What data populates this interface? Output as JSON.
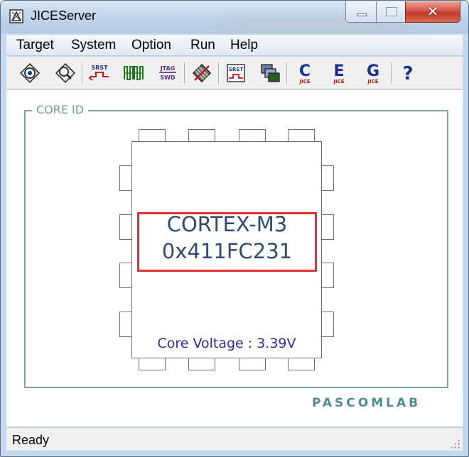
{
  "window": {
    "title": "JICEServer",
    "minimize_icon": "minimize-icon",
    "maximize_icon": "maximize-icon",
    "close_glyph": "✕"
  },
  "menu": {
    "items": [
      "Target",
      "System",
      "Option",
      "Run",
      "Help"
    ]
  },
  "toolbar": {
    "buttons": [
      {
        "icon": "connect-target-icon"
      },
      {
        "icon": "search-target-icon"
      },
      {
        "icon": "srst-reset-icon",
        "text": "SRST"
      },
      {
        "icon": "jtag-signals-icon"
      },
      {
        "icon": "jtag-swd-icon",
        "text_top": "JTAG",
        "text_bottom": "SWD"
      },
      {
        "icon": "chip-disconnect-icon"
      },
      {
        "icon": "srst-monitor-icon",
        "text": "SRST"
      },
      {
        "icon": "copy-layers-icon"
      },
      {
        "icon": "jice-c-icon",
        "letter": "C",
        "sub": "JICE"
      },
      {
        "icon": "jice-e-icon",
        "letter": "E",
        "sub": "JICE"
      },
      {
        "icon": "jice-g-icon",
        "letter": "G",
        "sub": "JICE"
      },
      {
        "icon": "help-icon",
        "letter": "?"
      }
    ]
  },
  "core": {
    "group_label": "CORE ID",
    "name": "CORTEX-M3",
    "id": "0x411FC231",
    "voltage_text": "Core Voltage : 3.39V"
  },
  "brand": "PASCOMLAB",
  "status": {
    "text": "Ready"
  },
  "colors": {
    "highlight": "#e03030",
    "core_text": "#2f4b6e",
    "voltage_text": "#2e2e9a",
    "frame": "#7fa6ad",
    "brand": "#4f8c91"
  }
}
